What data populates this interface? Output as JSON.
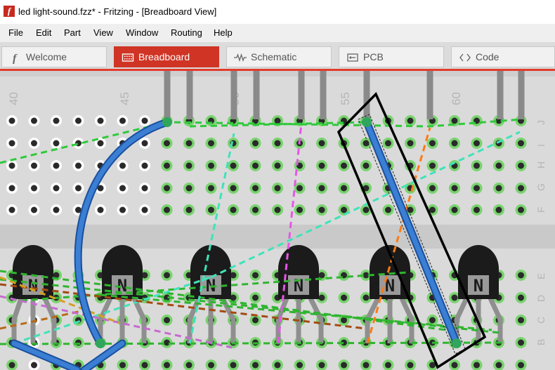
{
  "window": {
    "title": "led light-sound.fzz* - Fritzing - [Breadboard View]",
    "icon": "fritzing-logo-icon"
  },
  "menu": [
    "File",
    "Edit",
    "Part",
    "View",
    "Window",
    "Routing",
    "Help"
  ],
  "tabs": [
    {
      "label": "Welcome",
      "icon": "fritzing-f-icon",
      "active": false
    },
    {
      "label": "Breadboard",
      "icon": "breadboard-icon",
      "active": true
    },
    {
      "label": "Schematic",
      "icon": "schematic-icon",
      "active": false
    },
    {
      "label": "PCB",
      "icon": "pcb-icon",
      "active": false
    },
    {
      "label": "Code",
      "icon": "code-brackets-icon",
      "active": false
    }
  ],
  "breadboard": {
    "column_numbers": [
      "40",
      "45",
      "50",
      "55",
      "60"
    ],
    "row_letters_top": [
      "J",
      "I",
      "H",
      "G",
      "F"
    ],
    "row_letters_bottom": [
      "E",
      "D",
      "C",
      "B"
    ],
    "transistor_labels": [
      "N",
      "N",
      "N",
      "N",
      "N",
      "N"
    ]
  },
  "colors": {
    "accent": "#cf3424",
    "wire_blue": "#2f6fc3",
    "board": "#dadada",
    "hole_green": "#79d36e"
  }
}
